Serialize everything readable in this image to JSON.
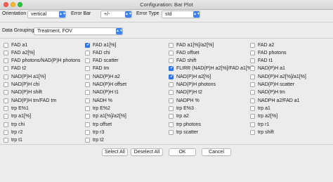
{
  "window": {
    "title": "Configuration: Bar Plot"
  },
  "controls": {
    "orientation_label": "Orientation",
    "orientation_value": "vertical",
    "error_bar_label": "Error Bar",
    "error_bar_value": "+/-",
    "error_type_label": "Error Type",
    "error_type_value": "std",
    "data_grouping_label": "Data Grouping",
    "data_grouping_value": "Treatment, FOV"
  },
  "features": [
    [
      "FAD a1",
      "FAD a1[%]",
      "FAD a1[%]/a2[%]",
      "FAD a2"
    ],
    [
      "FAD a2[%]",
      "FAD chi",
      "FAD offset",
      "FAD photons"
    ],
    [
      "FAD photons/NAD(P)H photons",
      "FAD scatter",
      "FAD shift",
      "FAD t1"
    ],
    [
      "FAD t2",
      "FAD tm",
      "FLIRR (NAD(P)H a2[%]/FAD a1[%])",
      "NAD(P)H a1"
    ],
    [
      "NAD(P)H a1[%]",
      "NAD(P)H a2",
      "NAD(P)H a2[%]",
      "NAD(P)H a2[%]/a1[%]"
    ],
    [
      "NAD(P)H chi",
      "NAD(P)H offset",
      "NAD(P)H photons",
      "NAD(P)H scatter"
    ],
    [
      "NAD(P)H shift",
      "NAD(P)H t1",
      "NAD(P)H t2",
      "NAD(P)H tm"
    ],
    [
      "NAD(P)H tm/FAD tm",
      "NADH %",
      "NADPH %",
      "NADPH a2/FAD a1"
    ],
    [
      "trp E%1",
      "trp E%2",
      "trp E%3",
      "trp a1"
    ],
    [
      "trp a1[%]",
      "trp a1[%]/a2[%]",
      "trp a2",
      "trp a2[%]"
    ],
    [
      "trp chi",
      "trp offset",
      "trp photons",
      "trp r1"
    ],
    [
      "trp r2",
      "trp r3",
      "trp scatter",
      "trp shift"
    ],
    [
      "trp t1",
      "trp t2",
      "",
      ""
    ]
  ],
  "checked": [
    [
      0,
      1
    ],
    [
      3,
      2
    ],
    [
      4,
      2
    ]
  ],
  "buttons": {
    "select_all": "Select All",
    "deselect_all": "Deselect All",
    "ok": "OK",
    "cancel": "Cancel"
  }
}
